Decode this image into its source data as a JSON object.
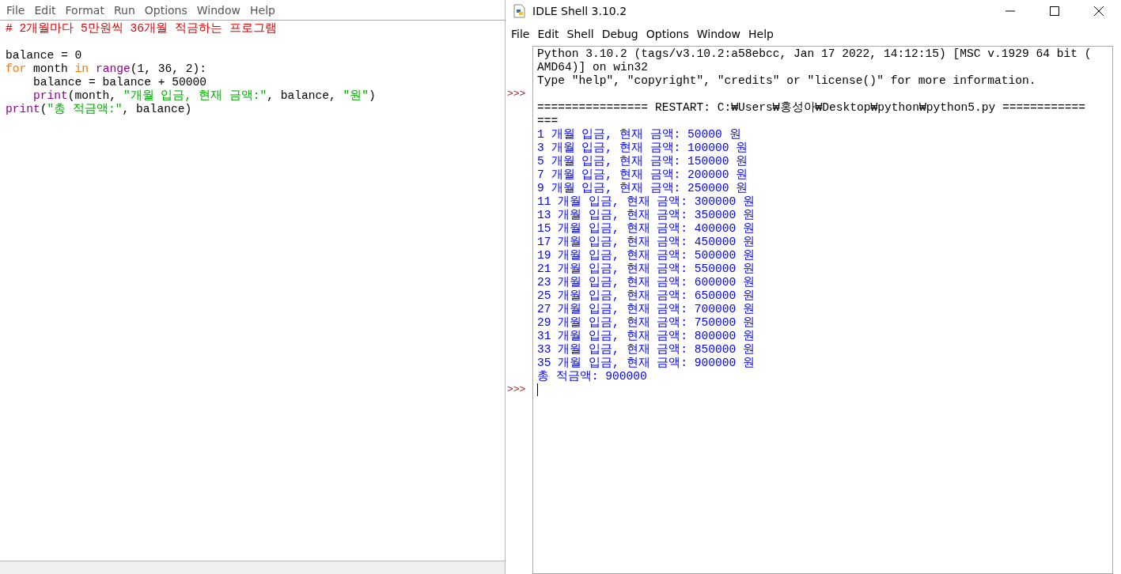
{
  "editor": {
    "menu": [
      "File",
      "Edit",
      "Format",
      "Run",
      "Options",
      "Window",
      "Help"
    ],
    "lines": [
      [
        {
          "text": "# 2개월마다 5만원씩 36개월 적금하는 프로그램",
          "kind": "comment"
        }
      ],
      [
        {
          "text": "\nbalance = 0",
          "kind": "plain"
        }
      ],
      [
        {
          "text": "for",
          "kind": "keyword"
        },
        {
          "text": " month ",
          "kind": "plain"
        },
        {
          "text": "in ",
          "kind": "keyword"
        },
        {
          "text": "range",
          "kind": "builtin"
        },
        {
          "text": "(1, 36, 2):",
          "kind": "plain"
        }
      ],
      [
        {
          "text": "    balance = balance + 50000",
          "kind": "plain"
        }
      ],
      [
        {
          "text": "    print",
          "kind": "builtin"
        },
        {
          "text": "(month, ",
          "kind": "plain"
        },
        {
          "text": "\"개월 입금, 현재 금액:\"",
          "kind": "string"
        },
        {
          "text": ", balance, ",
          "kind": "plain"
        },
        {
          "text": "\"원\"",
          "kind": "string"
        },
        {
          "text": ")",
          "kind": "plain"
        }
      ],
      [
        {
          "text": "print",
          "kind": "builtin"
        },
        {
          "text": "(",
          "kind": "plain"
        },
        {
          "text": "\"총 적금액:\"",
          "kind": "string"
        },
        {
          "text": ", balance)",
          "kind": "plain"
        }
      ]
    ]
  },
  "shell": {
    "title": "IDLE Shell 3.10.2",
    "menu": [
      "File",
      "Edit",
      "Shell",
      "Debug",
      "Options",
      "Window",
      "Help"
    ],
    "lines": [
      {
        "text": "Python 3.10.2 (tags/v3.10.2:a58ebcc, Jan 17 2022, 14:12:15) [MSC v.1929 64 bit (",
        "kind": "info"
      },
      {
        "text": "AMD64)] on win32",
        "kind": "info"
      },
      {
        "text": "Type \"help\", \"copyright\", \"credits\" or \"license()\" for more information.",
        "kind": "info"
      },
      {
        "kind": "info",
        "prompt": ">>>"
      },
      {
        "text": "================ RESTART: C:₩Users₩홍성아₩Desktop₩python₩python5.py ============",
        "kind": "info"
      },
      {
        "text": "===",
        "kind": "info"
      },
      {
        "text": "1 개월 입금, 현재 금액: 50000 원",
        "kind": "stdout"
      },
      {
        "text": "3 개월 입금, 현재 금액: 100000 원",
        "kind": "stdout"
      },
      {
        "text": "5 개월 입금, 현재 금액: 150000 원",
        "kind": "stdout"
      },
      {
        "text": "7 개월 입금, 현재 금액: 200000 원",
        "kind": "stdout"
      },
      {
        "text": "9 개월 입금, 현재 금액: 250000 원",
        "kind": "stdout"
      },
      {
        "text": "11 개월 입금, 현재 금액: 300000 원",
        "kind": "stdout"
      },
      {
        "text": "13 개월 입금, 현재 금액: 350000 원",
        "kind": "stdout"
      },
      {
        "text": "15 개월 입금, 현재 금액: 400000 원",
        "kind": "stdout"
      },
      {
        "text": "17 개월 입금, 현재 금액: 450000 원",
        "kind": "stdout"
      },
      {
        "text": "19 개월 입금, 현재 금액: 500000 원",
        "kind": "stdout"
      },
      {
        "text": "21 개월 입금, 현재 금액: 550000 원",
        "kind": "stdout"
      },
      {
        "text": "23 개월 입금, 현재 금액: 600000 원",
        "kind": "stdout"
      },
      {
        "text": "25 개월 입금, 현재 금액: 650000 원",
        "kind": "stdout"
      },
      {
        "text": "27 개월 입금, 현재 금액: 700000 원",
        "kind": "stdout"
      },
      {
        "text": "29 개월 입금, 현재 금액: 750000 원",
        "kind": "stdout"
      },
      {
        "text": "31 개월 입금, 현재 금액: 800000 원",
        "kind": "stdout"
      },
      {
        "text": "33 개월 입금, 현재 금액: 850000 원",
        "kind": "stdout"
      },
      {
        "text": "35 개월 입금, 현재 금액: 900000 원",
        "kind": "stdout"
      },
      {
        "text": "총 적금액: 900000",
        "kind": "stdout"
      },
      {
        "kind": "input",
        "prompt": ">>>"
      }
    ]
  }
}
